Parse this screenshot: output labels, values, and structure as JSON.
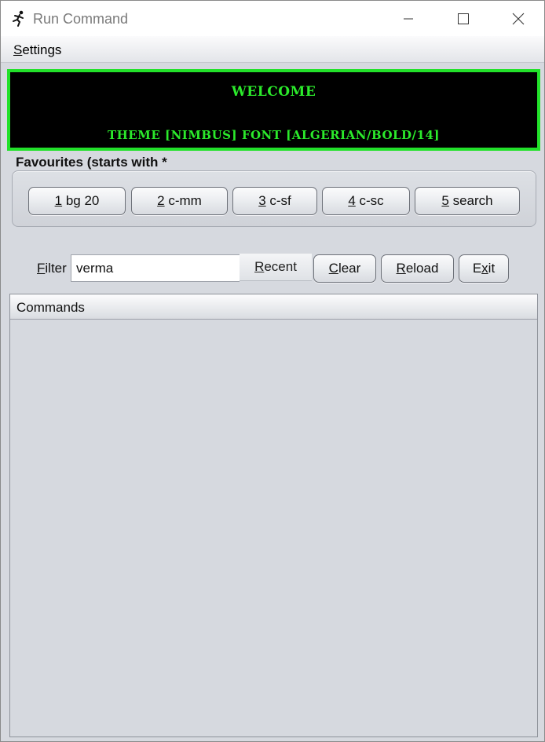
{
  "window": {
    "title": "Run Command",
    "icon": "running-man-icon"
  },
  "menu": {
    "settings_accel": "S",
    "settings_rest": "ettings"
  },
  "banner": {
    "line1": "WELCOME",
    "line2": "THEME [NIMBUS] FONT [ALGERIAN/BOLD/14]",
    "text_color": "#2bea2b",
    "border_color": "#22e12a",
    "background": "#000000"
  },
  "favourites": {
    "label": "Favourites (starts with *",
    "buttons": [
      {
        "accel": "1",
        "rest": " bg 20"
      },
      {
        "accel": "2",
        "rest": " c-mm"
      },
      {
        "accel": "3",
        "rest": " c-sf"
      },
      {
        "accel": "4",
        "rest": " c-sc"
      },
      {
        "accel": "5",
        "rest": " search"
      }
    ]
  },
  "filter": {
    "label_accel": "F",
    "label_rest": "ilter",
    "value": "verma"
  },
  "actions": {
    "recent": {
      "accel": "R",
      "rest": "ecent"
    },
    "clear": {
      "accel": "C",
      "rest": "lear"
    },
    "reload": {
      "accel": "R",
      "rest": "eload"
    },
    "exit": {
      "pre": "E",
      "accel": "x",
      "rest": "it"
    }
  },
  "commands": {
    "header": "Commands",
    "rows": []
  }
}
